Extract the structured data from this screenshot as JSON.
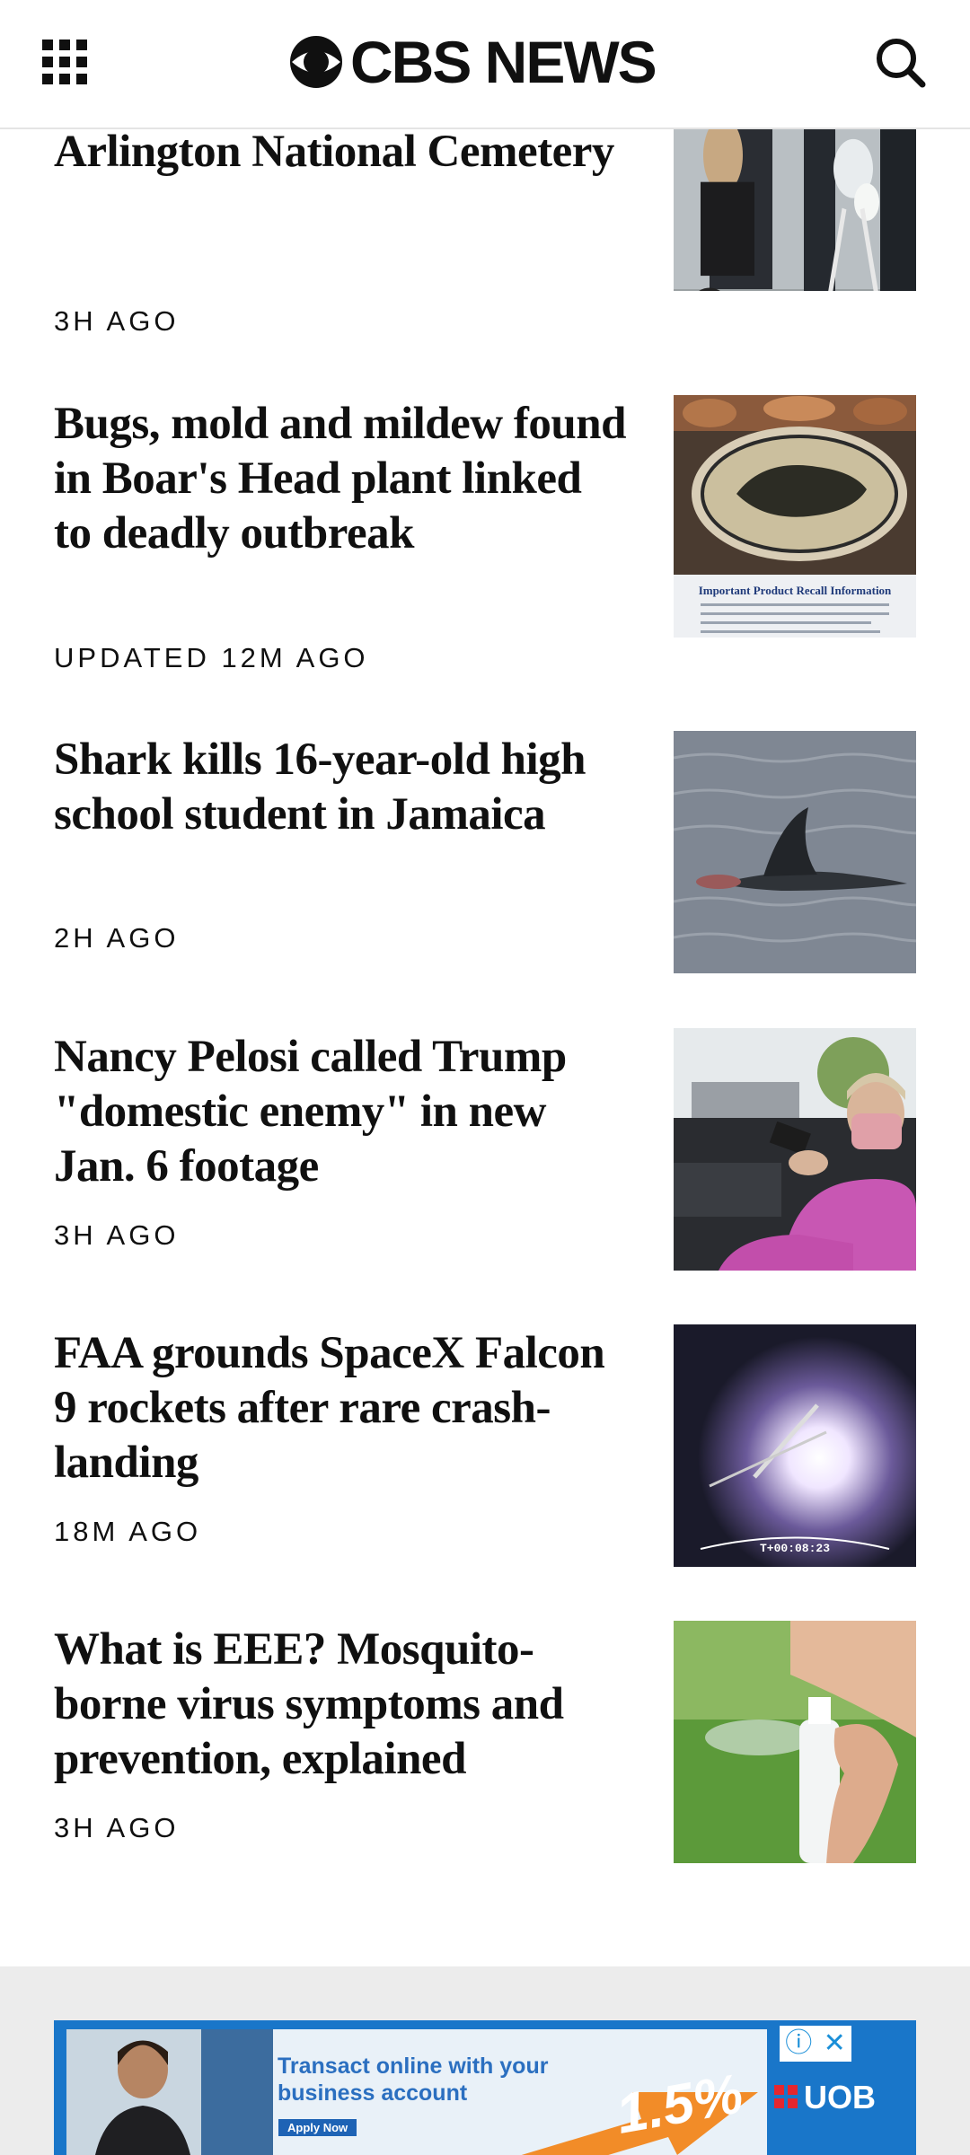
{
  "header": {
    "logo_text": "CBS NEWS"
  },
  "stories": [
    {
      "title": "involved in incident at Arlington National Cemetery",
      "time": "3H AGO"
    },
    {
      "title": "Bugs, mold and mildew found in Boar's Head plant linked to deadly outbreak",
      "time": "UPDATED 12M AGO"
    },
    {
      "title": "Shark kills 16-year-old high school student in Jamaica",
      "time": "2H AGO"
    },
    {
      "title": "Nancy Pelosi called Trump \"domestic enemy\" in new Jan. 6 footage",
      "time": "3H AGO"
    },
    {
      "title": "FAA grounds SpaceX Falcon 9 rockets after rare crash-landing",
      "time": "18M AGO"
    },
    {
      "title": "What is EEE? Mosquito-borne virus symptoms and prevention, explained",
      "time": "3H AGO"
    }
  ],
  "thumbnails": {
    "recall_heading": "Important Product Recall Information",
    "spacex_timer": "T+00:08:23"
  },
  "ad": {
    "headline": "Transact online with your business account",
    "apply_label": "Apply Now",
    "rate": "1.5%",
    "brand": "UOB",
    "info_icon_glyph": "ⓘ",
    "close_icon_glyph": "✕"
  },
  "colors": {
    "text": "#101010",
    "divider": "#e4e4e4",
    "ad_background": "#ececec",
    "ad_blue": "#1976c9",
    "ad_orange": "#f28c28",
    "ad_red": "#e5262e"
  },
  "icons": [
    "menu-grid-icon",
    "cbs-eye-icon",
    "search-icon",
    "info-icon",
    "close-icon"
  ]
}
